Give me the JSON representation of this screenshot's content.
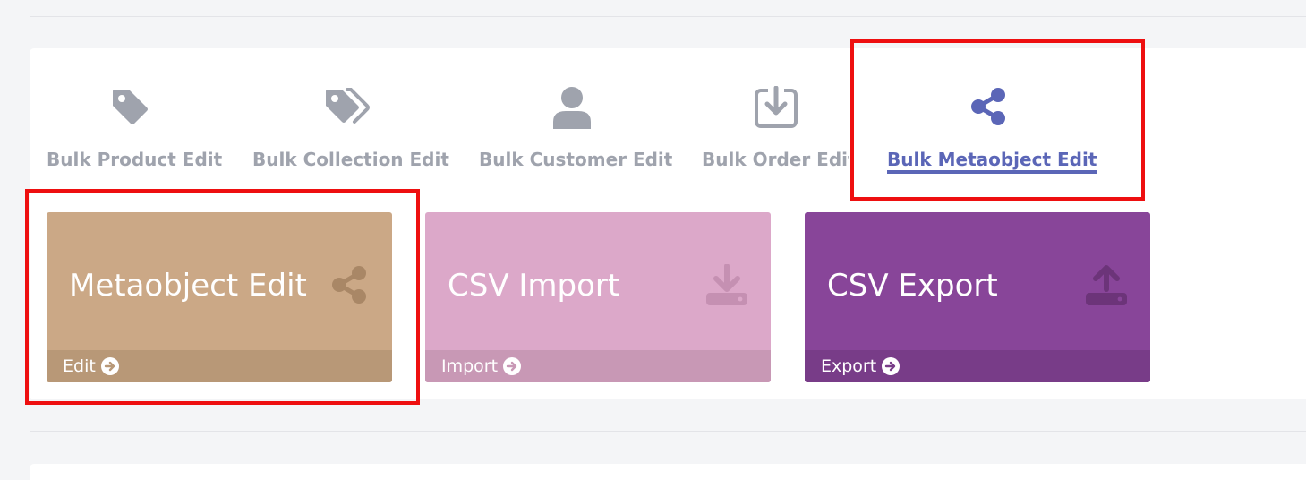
{
  "tabs": [
    {
      "label": "Bulk Product Edit",
      "icon": "tag-icon",
      "active": false
    },
    {
      "label": "Bulk Collection Edit",
      "icon": "tags-icon",
      "active": false
    },
    {
      "label": "Bulk Customer Edit",
      "icon": "user-icon",
      "active": false
    },
    {
      "label": "Bulk Order Edit",
      "icon": "download-box-icon",
      "active": false
    },
    {
      "label": "Bulk Metaobject Edit",
      "icon": "share-icon",
      "active": true
    }
  ],
  "cards": [
    {
      "title": "Metaobject Edit",
      "action": "Edit",
      "icon": "share-icon",
      "color": "#cba886",
      "footer_color": "#b89877"
    },
    {
      "title": "CSV Import",
      "action": "Import",
      "icon": "download-icon",
      "color": "#dca8c9",
      "footer_color": "#c898b5"
    },
    {
      "title": "CSV Export",
      "action": "Export",
      "icon": "upload-icon",
      "color": "#884599",
      "footer_color": "#783c88"
    }
  ],
  "colors": {
    "accent": "#5b66b7",
    "inactive": "#9fa3ad",
    "highlight": "#ee0f10"
  }
}
